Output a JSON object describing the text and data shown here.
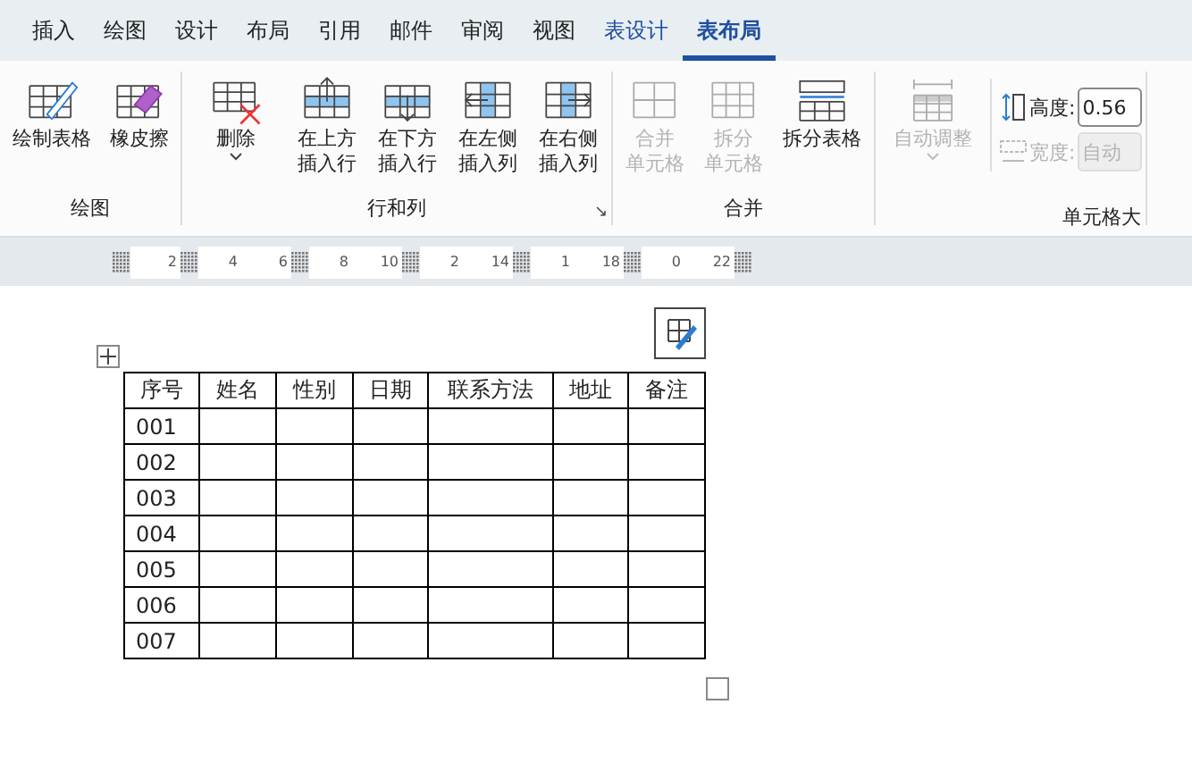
{
  "tabs": [
    {
      "label": "插入",
      "selected": false
    },
    {
      "label": "绘图",
      "selected": false
    },
    {
      "label": "设计",
      "selected": false
    },
    {
      "label": "布局",
      "selected": false
    },
    {
      "label": "引用",
      "selected": false
    },
    {
      "label": "邮件",
      "selected": false
    },
    {
      "label": "审阅",
      "selected": false
    },
    {
      "label": "视图",
      "selected": false
    },
    {
      "label": "表设计",
      "selected": false,
      "kind": "context"
    },
    {
      "label": "表布局",
      "selected": true,
      "kind": "context"
    }
  ],
  "groups": [
    {
      "title": "绘图",
      "buttons": [
        {
          "kind": "draw",
          "label": [
            "绘制表格"
          ],
          "disabled": false
        },
        {
          "kind": "eraser",
          "label": [
            "橡皮擦"
          ],
          "disabled": false
        }
      ]
    },
    {
      "title": "行和列",
      "launcher": "↘",
      "buttons": [
        {
          "kind": "delete",
          "label": [
            "删除"
          ],
          "dropdown": true,
          "disabled": false
        },
        {
          "kind": "above",
          "label": [
            "在上方",
            "插入行"
          ],
          "disabled": false
        },
        {
          "kind": "below",
          "label": [
            "在下方",
            "插入行"
          ],
          "disabled": false
        },
        {
          "kind": "left",
          "label": [
            "在左侧",
            "插入列"
          ],
          "disabled": false
        },
        {
          "kind": "right",
          "label": [
            "在右侧",
            "插入列"
          ],
          "disabled": false
        }
      ]
    },
    {
      "title": "合并",
      "buttons": [
        {
          "kind": "merge",
          "label": [
            "合并",
            "单元格"
          ],
          "disabled": true
        },
        {
          "kind": "split",
          "label": [
            "拆分",
            "单元格"
          ],
          "disabled": true
        },
        {
          "kind": "splittable",
          "label": [
            "拆分表格"
          ],
          "disabled": false
        }
      ]
    },
    {
      "title": "单元格大",
      "buttons": [
        {
          "kind": "autofit",
          "label": [
            "自动调整"
          ],
          "dropdown": true,
          "disabled": true
        }
      ],
      "fields": [
        {
          "kind": "height",
          "label": "高度:",
          "value": "0.56",
          "disabled": false
        },
        {
          "kind": "width",
          "label": "宽度:",
          "value": "自动",
          "disabled": true
        }
      ]
    }
  ],
  "ruler": [
    "2",
    "4",
    "6",
    "8",
    "10",
    "2",
    "14",
    "1",
    "18",
    "0",
    "22"
  ],
  "table": {
    "rows": [
      [
        "序号",
        "姓名",
        "性别",
        "日期",
        "联系方法",
        "地址",
        "备注"
      ],
      [
        "001",
        "",
        "",
        "",
        "",
        "",
        ""
      ],
      [
        "002",
        "",
        "",
        "",
        "",
        "",
        ""
      ],
      [
        "003",
        "",
        "",
        "",
        "",
        "",
        ""
      ],
      [
        "004",
        "",
        "",
        "",
        "",
        "",
        ""
      ],
      [
        "005",
        "",
        "",
        "",
        "",
        "",
        ""
      ],
      [
        "006",
        "",
        "",
        "",
        "",
        "",
        ""
      ],
      [
        "007",
        "",
        "",
        "",
        "",
        "",
        ""
      ]
    ]
  }
}
